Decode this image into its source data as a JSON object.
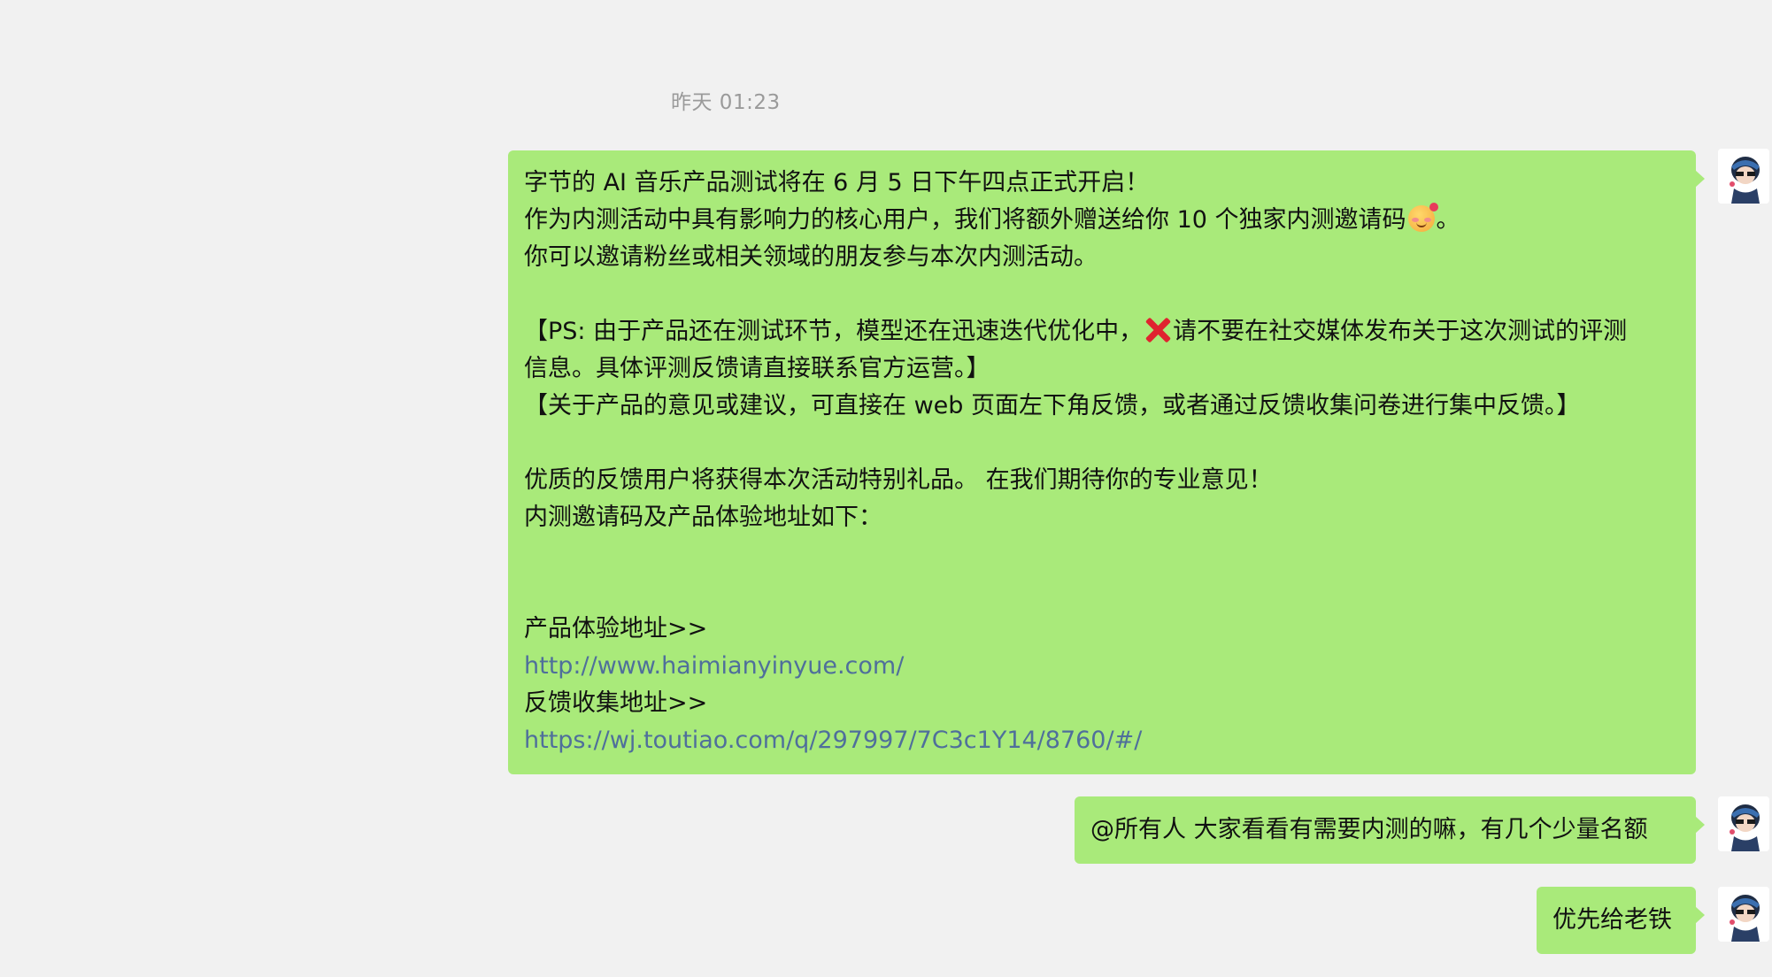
{
  "chat": {
    "timestamp": "昨天 01:23",
    "messages": [
      {
        "lines": [
          "字节的 AI 音乐产品测试将在 6 月 5 日下午四点正式开启！",
          "作为内测活动中具有影响力的核心用户，我们将额外赠送给你 10 个独家内测邀请码",
          "。",
          "你可以邀请粉丝或相关领域的朋友参与本次内测活动。",
          "【PS: 由于产品还在测试环节，模型还在迅速迭代优化中，",
          "请不要在社交媒体发布关于这次测试的评测",
          "信息。具体评测反馈请直接联系官方运营。】",
          "【关于产品的意见或建议，可直接在 web 页面左下角反馈，或者通过反馈收集问卷进行集中反馈。】",
          "优质的反馈用户将获得本次活动特别礼品。 在我们期待你的专业意见！",
          "内测邀请码及产品体验地址如下：",
          "产品体验地址>>",
          "http://www.haimianyinyue.com/",
          "反馈收集地址>>",
          "https://wj.toutiao.com/q/297997/7C3c1Y14/8760/#/"
        ]
      },
      {
        "text": "@所有人 大家看看有需要内测的嘛，有几个少量名额"
      },
      {
        "text": "优先给老铁"
      }
    ],
    "icons": {
      "avatar": "avatar-icon",
      "cross": "cross-mark-icon",
      "smile": "smiling-face-with-hearts-icon"
    },
    "colors": {
      "background": "#f1f1f1",
      "bubble": "#a9ea7a",
      "link": "#4f6f9b",
      "timestamp": "#9a9a9a"
    }
  }
}
